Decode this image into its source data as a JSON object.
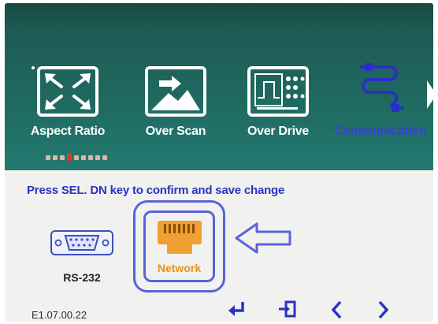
{
  "menu": {
    "items": [
      {
        "label": "Aspect Ratio",
        "icon": "aspect-ratio-icon"
      },
      {
        "label": "Over Scan",
        "icon": "over-scan-icon"
      },
      {
        "label": "Over Drive",
        "icon": "over-drive-icon"
      },
      {
        "label": "Communication",
        "icon": "communication-cable-icon",
        "selected": true
      }
    ],
    "page_indicator": {
      "total": 9,
      "active": 4
    }
  },
  "instruction": "Press SEL. DN key to confirm and save change",
  "options": [
    {
      "label": "RS-232",
      "icon": "serial-port-icon"
    },
    {
      "label": "Network",
      "icon": "ethernet-port-icon",
      "selected": true
    }
  ],
  "version": "E1.07.00.22",
  "nav_buttons": [
    "enter-icon",
    "exit-icon",
    "left-arrow-icon",
    "right-arrow-icon"
  ],
  "colors": {
    "menu_background": "#1f6a61",
    "selected_label": "#3a3fd8",
    "instruction_text": "#2a33c0",
    "network_orange": "#e8901c",
    "highlight_outline": "#5a63d8"
  }
}
